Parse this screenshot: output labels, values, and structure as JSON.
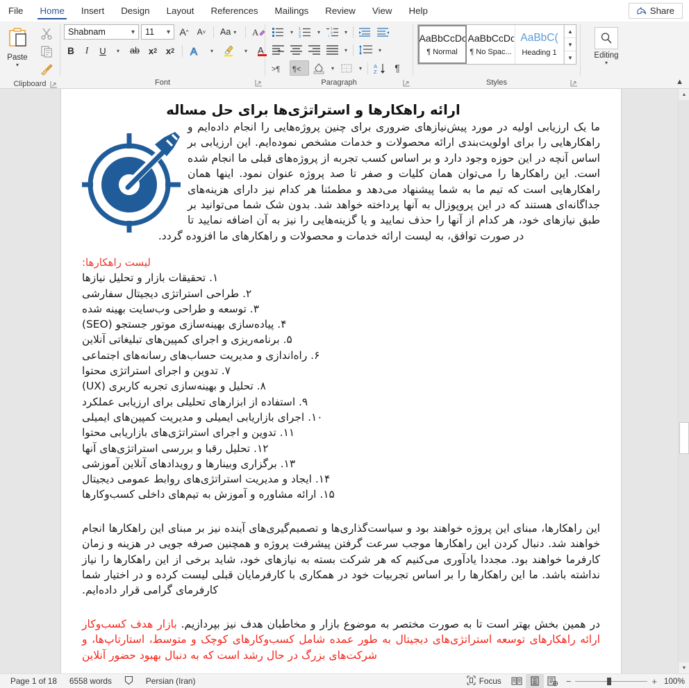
{
  "app": {
    "share_label": "Share"
  },
  "tabs": [
    {
      "label": "File",
      "active": false
    },
    {
      "label": "Home",
      "active": true
    },
    {
      "label": "Insert",
      "active": false
    },
    {
      "label": "Design",
      "active": false
    },
    {
      "label": "Layout",
      "active": false
    },
    {
      "label": "References",
      "active": false
    },
    {
      "label": "Mailings",
      "active": false
    },
    {
      "label": "Review",
      "active": false
    },
    {
      "label": "View",
      "active": false
    },
    {
      "label": "Help",
      "active": false
    }
  ],
  "ribbon": {
    "clipboard": {
      "group_label": "Clipboard",
      "paste_label": "Paste",
      "cut_icon": "scissors-icon",
      "copy_icon": "copy-icon",
      "format_painter_icon": "format-painter-icon"
    },
    "font": {
      "group_label": "Font",
      "font_name": "Shabnam",
      "font_size": "11",
      "grow_font": "A",
      "shrink_font": "A",
      "change_case": "Aa",
      "clear_formatting_icon": "clear-formatting-icon",
      "bold": "B",
      "italic": "I",
      "underline": "U",
      "strikethrough": "ab",
      "subscript": "x",
      "subscript_sup": "2",
      "superscript": "x",
      "superscript_sup": "2",
      "text_effects": "A",
      "highlight": "A",
      "font_color": "A"
    },
    "paragraph": {
      "group_label": "Paragraph",
      "bullets_icon": "bullets-icon",
      "numbering_icon": "numbering-icon",
      "multilevel_icon": "multilevel-list-icon",
      "decrease_indent_icon": "decrease-indent-icon",
      "increase_indent_icon": "increase-indent-icon",
      "align_left_icon": "align-left-icon",
      "align_center_icon": "align-center-icon",
      "align_right_icon": "align-right-icon",
      "justify_icon": "justify-icon",
      "line_spacing_icon": "line-spacing-icon",
      "ltr_icon": "left-to-right-icon",
      "rtl_icon": "right-to-left-icon",
      "shading_icon": "shading-icon",
      "borders_icon": "borders-icon",
      "sort_icon": "sort-icon",
      "show_marks_icon": "show-formatting-marks-icon"
    },
    "styles": {
      "group_label": "Styles",
      "items": [
        {
          "preview": "AaBbCcDc",
          "name": "¶ Normal",
          "selected": true
        },
        {
          "preview": "AaBbCcDc",
          "name": "¶ No Spac...",
          "selected": false
        },
        {
          "preview": "AaBbC(",
          "name": "Heading 1",
          "selected": false
        }
      ]
    },
    "editing": {
      "group_label": "",
      "label": "Editing",
      "icon": "search-icon"
    }
  },
  "document": {
    "heading": "ارائه راهکارها و استراتژی‌ها برای حل مساله",
    "intro_paragraph": "ما یک ارزیابی اولیه در مورد پیش‌نیازهای ضروری برای چنین پروژه‌هایی را انجام داده‌ایم و راهکارهایی را برای اولویت‌بندی ارائه محصولات و خدمات مشخص نموده‌ایم. این ارزیابی بر اساس آنچه در این حوزه وجود دارد و بر اساس کسب تجربه از پروژه‌های قبلی ما انجام شده است. این راهکارها را می‌توان همان کلیات و صفر تا صد پروژه عنوان نمود. اینها همان راهکارهایی است که تیم ما به شما پیشنهاد می‌دهد و مطمئنا هر کدام نیز دارای هزینه‌های جداگانه‌ای هستند که در این پروپوزال به آنها پرداخته خواهد شد. بدون شک شما می‌توانید بر طبق نیازهای خود، هر کدام از آنها را حذف نمایید و یا گزینه‌هایی را نیز به آن اضافه نمایید تا در صورت توافق، به لیست ارائه خدمات و محصولات و راهکارهای ما افزوده گردد.",
    "list_title": "لیست راهکارها:",
    "list_items": [
      "۱. تحقیقات بازار و تحلیل نیازها",
      "۲. طراحی استراتژی دیجیتال سفارشی",
      "۳. توسعه و طراحی وب‌سایت بهینه شده",
      "۴. پیاده‌سازی بهینه‌سازی موتور جستجو (SEO)",
      "۵. برنامه‌ریزی و اجرای کمپین‌های تبلیغاتی آنلاین",
      "۶. راه‌اندازی و مدیریت حساب‌های رسانه‌های اجتماعی",
      "۷. تدوین و اجرای استراتژی محتوا",
      "۸. تحلیل و بهینه‌سازی تجربه کاربری (UX)",
      "۹. استفاده از ابزارهای تحلیلی برای ارزیابی عملکرد",
      "۱۰. اجرای بازاریابی ایمیلی و مدیریت کمپین‌های ایمیلی",
      "۱۱. تدوین و اجرای استراتژی‌های بازاریابی محتوا",
      "۱۲. تحلیل رقبا و بررسی استراتژی‌های آنها",
      "۱۳. برگزاری وبینارها و رویدادهای آنلاین آموزشی",
      "۱۴. ایجاد و مدیریت استراتژی‌های روابط عمومی دیجیتال",
      "۱۵. ارائه مشاوره و آموزش به تیم‌های داخلی کسب‌وکارها"
    ],
    "paragraph_2": "این راهکارها، مبنای این پروژه خواهند بود و سیاست‌گذاری‌ها و تصمیم‌گیری‌های آینده نیز بر مبنای این راهکارها انجام خواهند شد. دنبال کردن این راهکارها موجب سرعت گرفتن پیشرفت پروژه و همچنین صرفه جویی در هزینه و زمان کارفرما خواهند بود. مجددا یادآوری می‌کنیم که هر شرکت بسته به نیازهای خود، شاید برخی از این راهکارها را نیاز نداشته باشد. ما این راهکارها را بر اساس تجربیات خود در همکاری با کارفرمایان قبلی لیست کرده و در اختیار شما کارفرمای گرامی قرار داده‌ایم.",
    "paragraph_3_black": "در همین بخش بهتر است تا به صورت مختصر به موضوع بازار و مخاطبان هدف نیز بپردازیم. ",
    "paragraph_3_red": "بازار هدف کسب‌وکار ارائه راهکارهای توسعه استراتژی‌های دیجیتال به طور عمده شامل کسب‌وکارهای کوچک و متوسط، استارتاپ‌ها، و شرکت‌های بزرگ در حال رشد است که به دنبال بهبود حضور آنلاین",
    "icon": "target-arrow-icon",
    "colors": {
      "icon_blue": "#1f5c99",
      "accent_red": "#f4261c",
      "heading_red": "#e8382b"
    }
  },
  "status_bar": {
    "page": "Page 1 of 18",
    "words": "6558 words",
    "proofing_icon": "proofing-icon",
    "language": "Persian (Iran)",
    "focus": "Focus",
    "focus_icon": "focus-icon",
    "view_read": "read-mode-icon",
    "view_print": "print-layout-icon",
    "view_web": "web-layout-icon",
    "zoom_out": "−",
    "zoom_in": "+",
    "zoom_level": "100%"
  }
}
